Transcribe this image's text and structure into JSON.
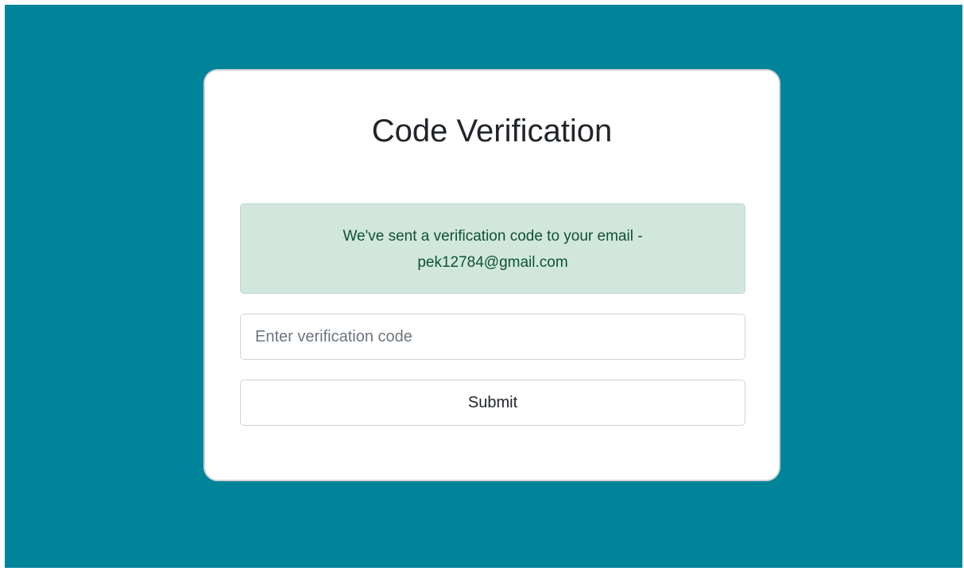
{
  "card": {
    "title": "Code Verification",
    "alert": {
      "line1": "We've sent a verification code to your email -",
      "line2": "pek12784@gmail.com"
    },
    "code_input": {
      "placeholder": "Enter verification code",
      "value": ""
    },
    "submit_label": "Submit"
  },
  "colors": {
    "background": "#008499",
    "alert_bg": "#d1e7dd",
    "alert_text": "#0f5132"
  }
}
